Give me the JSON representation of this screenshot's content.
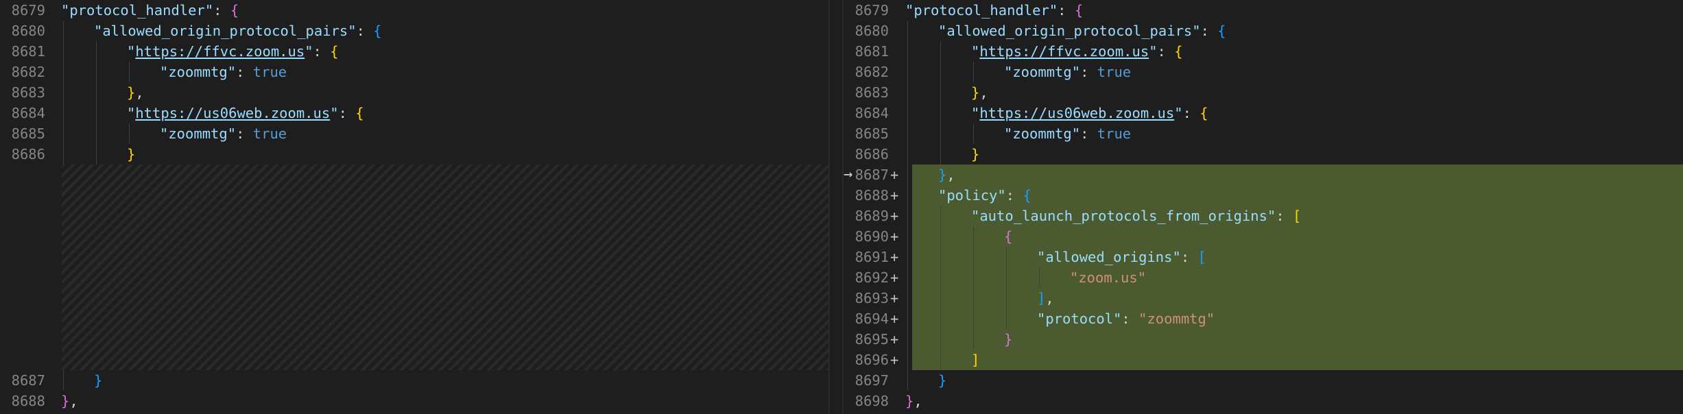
{
  "diff": {
    "left": {
      "lines": [
        {
          "num": "8679",
          "indent": 0,
          "tokens": [
            {
              "t": "\"protocol_handler\"",
              "c": "key"
            },
            {
              "t": ": ",
              "c": "punc"
            },
            {
              "t": "{",
              "c": "b1"
            }
          ]
        },
        {
          "num": "8680",
          "indent": 1,
          "tokens": [
            {
              "t": "\"allowed_origin_protocol_pairs\"",
              "c": "key"
            },
            {
              "t": ": ",
              "c": "punc"
            },
            {
              "t": "{",
              "c": "b2"
            }
          ]
        },
        {
          "num": "8681",
          "indent": 2,
          "tokens": [
            {
              "t": "\"",
              "c": "key"
            },
            {
              "t": "https://ffvc.zoom.us",
              "c": "link"
            },
            {
              "t": "\"",
              "c": "key"
            },
            {
              "t": ": ",
              "c": "punc"
            },
            {
              "t": "{",
              "c": "b3"
            }
          ]
        },
        {
          "num": "8682",
          "indent": 3,
          "tokens": [
            {
              "t": "\"zoommtg\"",
              "c": "key"
            },
            {
              "t": ": ",
              "c": "punc"
            },
            {
              "t": "true",
              "c": "bool"
            }
          ]
        },
        {
          "num": "8683",
          "indent": 2,
          "tokens": [
            {
              "t": "}",
              "c": "b3"
            },
            {
              "t": ",",
              "c": "punc"
            }
          ]
        },
        {
          "num": "8684",
          "indent": 2,
          "tokens": [
            {
              "t": "\"",
              "c": "key"
            },
            {
              "t": "https://us06web.zoom.us",
              "c": "link"
            },
            {
              "t": "\"",
              "c": "key"
            },
            {
              "t": ": ",
              "c": "punc"
            },
            {
              "t": "{",
              "c": "b3"
            }
          ]
        },
        {
          "num": "8685",
          "indent": 3,
          "tokens": [
            {
              "t": "\"zoommtg\"",
              "c": "key"
            },
            {
              "t": ": ",
              "c": "punc"
            },
            {
              "t": "true",
              "c": "bool"
            }
          ]
        },
        {
          "num": "8686",
          "indent": 2,
          "tokens": [
            {
              "t": "}",
              "c": "b3"
            }
          ]
        },
        {
          "num": "",
          "indent": 0,
          "tokens": []
        },
        {
          "num": "",
          "indent": 0,
          "tokens": []
        },
        {
          "num": "",
          "indent": 0,
          "tokens": []
        },
        {
          "num": "",
          "indent": 0,
          "tokens": []
        },
        {
          "num": "",
          "indent": 0,
          "tokens": []
        },
        {
          "num": "",
          "indent": 0,
          "tokens": []
        },
        {
          "num": "",
          "indent": 0,
          "tokens": []
        },
        {
          "num": "",
          "indent": 0,
          "tokens": []
        },
        {
          "num": "",
          "indent": 0,
          "tokens": []
        },
        {
          "num": "",
          "indent": 0,
          "tokens": []
        },
        {
          "num": "8687",
          "indent": 1,
          "tokens": [
            {
              "t": "}",
              "c": "b2"
            }
          ]
        },
        {
          "num": "8688",
          "indent": 0,
          "tokens": [
            {
              "t": "}",
              "c": "b1"
            },
            {
              "t": ",",
              "c": "punc"
            }
          ]
        }
      ]
    },
    "right": {
      "arrow": "→",
      "lines": [
        {
          "num": "8679",
          "mark": "",
          "indent": 0,
          "tokens": [
            {
              "t": "\"protocol_handler\"",
              "c": "key"
            },
            {
              "t": ": ",
              "c": "punc"
            },
            {
              "t": "{",
              "c": "b1"
            }
          ]
        },
        {
          "num": "8680",
          "mark": "",
          "indent": 1,
          "tokens": [
            {
              "t": "\"allowed_origin_protocol_pairs\"",
              "c": "key"
            },
            {
              "t": ": ",
              "c": "punc"
            },
            {
              "t": "{",
              "c": "b2"
            }
          ]
        },
        {
          "num": "8681",
          "mark": "",
          "indent": 2,
          "tokens": [
            {
              "t": "\"",
              "c": "key"
            },
            {
              "t": "https://ffvc.zoom.us",
              "c": "link"
            },
            {
              "t": "\"",
              "c": "key"
            },
            {
              "t": ": ",
              "c": "punc"
            },
            {
              "t": "{",
              "c": "b3"
            }
          ]
        },
        {
          "num": "8682",
          "mark": "",
          "indent": 3,
          "tokens": [
            {
              "t": "\"zoommtg\"",
              "c": "key"
            },
            {
              "t": ": ",
              "c": "punc"
            },
            {
              "t": "true",
              "c": "bool"
            }
          ]
        },
        {
          "num": "8683",
          "mark": "",
          "indent": 2,
          "tokens": [
            {
              "t": "}",
              "c": "b3"
            },
            {
              "t": ",",
              "c": "punc"
            }
          ]
        },
        {
          "num": "8684",
          "mark": "",
          "indent": 2,
          "tokens": [
            {
              "t": "\"",
              "c": "key"
            },
            {
              "t": "https://us06web.zoom.us",
              "c": "link"
            },
            {
              "t": "\"",
              "c": "key"
            },
            {
              "t": ": ",
              "c": "punc"
            },
            {
              "t": "{",
              "c": "b3"
            }
          ]
        },
        {
          "num": "8685",
          "mark": "",
          "indent": 3,
          "tokens": [
            {
              "t": "\"zoommtg\"",
              "c": "key"
            },
            {
              "t": ": ",
              "c": "punc"
            },
            {
              "t": "true",
              "c": "bool"
            }
          ]
        },
        {
          "num": "8686",
          "mark": "",
          "indent": 2,
          "tokens": [
            {
              "t": "}",
              "c": "b3"
            }
          ]
        },
        {
          "num": "8687",
          "mark": "+",
          "indent": 1,
          "tokens": [
            {
              "t": "}",
              "c": "b2"
            },
            {
              "t": ",",
              "c": "punc"
            }
          ]
        },
        {
          "num": "8688",
          "mark": "+",
          "indent": 1,
          "tokens": [
            {
              "t": "\"policy\"",
              "c": "key"
            },
            {
              "t": ": ",
              "c": "punc"
            },
            {
              "t": "{",
              "c": "b2"
            }
          ]
        },
        {
          "num": "8689",
          "mark": "+",
          "indent": 2,
          "tokens": [
            {
              "t": "\"auto_launch_protocols_from_origins\"",
              "c": "key"
            },
            {
              "t": ": ",
              "c": "punc"
            },
            {
              "t": "[",
              "c": "b3"
            }
          ]
        },
        {
          "num": "8690",
          "mark": "+",
          "indent": 3,
          "tokens": [
            {
              "t": "{",
              "c": "b1"
            }
          ]
        },
        {
          "num": "8691",
          "mark": "+",
          "indent": 4,
          "tokens": [
            {
              "t": "\"allowed_origins\"",
              "c": "key"
            },
            {
              "t": ": ",
              "c": "punc"
            },
            {
              "t": "[",
              "c": "b2"
            }
          ]
        },
        {
          "num": "8692",
          "mark": "+",
          "indent": 5,
          "tokens": [
            {
              "t": "\"zoom.us\"",
              "c": "str"
            }
          ]
        },
        {
          "num": "8693",
          "mark": "+",
          "indent": 4,
          "tokens": [
            {
              "t": "]",
              "c": "b2"
            },
            {
              "t": ",",
              "c": "punc"
            }
          ]
        },
        {
          "num": "8694",
          "mark": "+",
          "indent": 4,
          "tokens": [
            {
              "t": "\"protocol\"",
              "c": "key"
            },
            {
              "t": ": ",
              "c": "punc"
            },
            {
              "t": "\"zoommtg\"",
              "c": "str"
            }
          ]
        },
        {
          "num": "8695",
          "mark": "+",
          "indent": 3,
          "tokens": [
            {
              "t": "}",
              "c": "b1"
            }
          ]
        },
        {
          "num": "8696",
          "mark": "+",
          "indent": 2,
          "tokens": [
            {
              "t": "]",
              "c": "b3"
            }
          ]
        },
        {
          "num": "8697",
          "mark": "",
          "indent": 1,
          "tokens": [
            {
              "t": "}",
              "c": "b2"
            }
          ]
        },
        {
          "num": "8698",
          "mark": "",
          "indent": 0,
          "tokens": [
            {
              "t": "}",
              "c": "b1"
            },
            {
              "t": ",",
              "c": "punc"
            }
          ]
        }
      ]
    }
  }
}
